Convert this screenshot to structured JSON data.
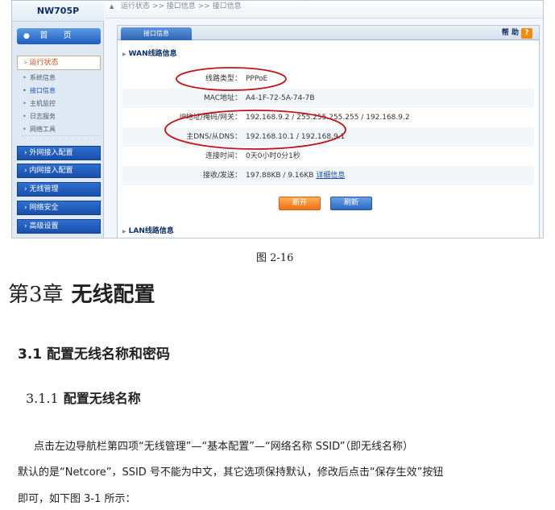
{
  "router": {
    "model": "NW705P",
    "home": "首 页",
    "breadcrumb": "运行状态 >> 接口信息 >> 接口信息",
    "menu": {
      "active_category": "› 运行状态",
      "subitems": [
        "系统信息",
        "接口信息",
        "主机监控",
        "日志服务",
        "网络工具"
      ],
      "active_subitem": "接口信息",
      "categories": [
        "› 外网接入配置",
        "› 内网接入配置",
        "› 无线管理",
        "› 网络安全",
        "› 高级设置"
      ]
    },
    "panel": {
      "tab": "接口信息",
      "help": "帮 助",
      "help_icon": "?",
      "wan_section": "WAN线路信息",
      "lan_section": "LAN线路信息",
      "rows": [
        {
          "label": "线路类型：",
          "value": "PPPoE"
        },
        {
          "label": "MAC地址：",
          "value": "A4-1F-72-5A-74-7B"
        },
        {
          "label": "IP地址/掩码/网关：",
          "value": "192.168.9.2 / 255.255.255.255 / 192.168.9.2"
        },
        {
          "label": "主DNS/从DNS：",
          "value": "192.168.10.1 / 192.168.9.1"
        },
        {
          "label": "连接时间：",
          "value": "0天0小时0分1秒"
        },
        {
          "label": "接收/发送：",
          "value": "197.88KB / 9.16KB",
          "link": "详细信息"
        }
      ],
      "disconnect_button": "断开",
      "refresh_button": "刷新"
    },
    "annotation_color": "#c0141a"
  },
  "document": {
    "figure_caption": "图 2-16",
    "chapter_number": "第3章",
    "chapter_title": "无线配置",
    "section_title": "3.1 配置无线名称和密码",
    "subsection_number": "3.1.1",
    "subsection_title": "配置无线名称",
    "paragraph_lines": [
      "点击左边导航栏第四项“无线管理”—“基本配置”—“网络名称 SSID”（即无线名称）",
      "默认的是“Netcore”，SSID 号不能为中文，其它选项保持默认，修改后点击“保存生效”按钮",
      "即可，如下图 3-1 所示："
    ]
  }
}
